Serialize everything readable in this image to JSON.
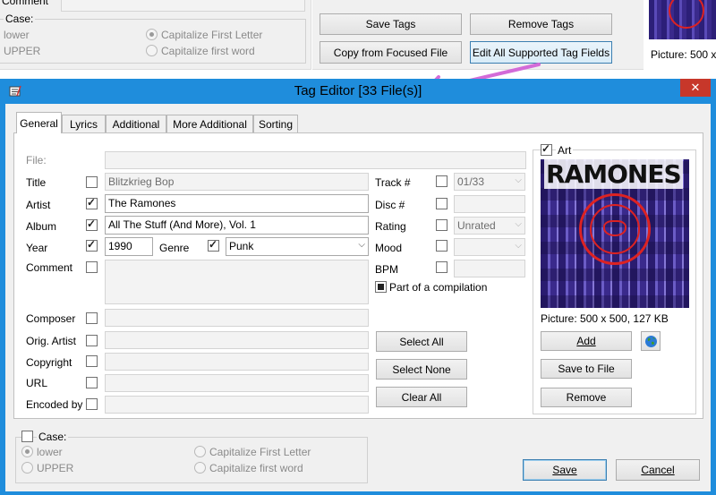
{
  "background_window": {
    "comment_label": "Comment",
    "case_label": "Case:",
    "lower_label": "lower",
    "upper_label": "UPPER",
    "capitalize_first_letter": "Capitalize First Letter",
    "capitalize_first_word": "Capitalize first word",
    "buttons": {
      "save_tags": "Save Tags",
      "remove_tags": "Remove Tags",
      "copy_from_focused": "Copy from Focused File",
      "edit_all_supported": "Edit All Supported Tag Fields"
    },
    "picture_info": "Picture: 500 x"
  },
  "dialog": {
    "title": "Tag Editor [33 File(s)]",
    "close_glyph": "✕",
    "tabs": [
      "General",
      "Lyrics",
      "Additional",
      "More Additional",
      "Sorting"
    ],
    "fields": {
      "file_label": "File:",
      "title_label": "Title",
      "title_value": "Blitzkrieg Bop",
      "artist_label": "Artist",
      "artist_value": "The Ramones",
      "album_label": "Album",
      "album_value": "All The Stuff (And More), Vol. 1",
      "year_label": "Year",
      "year_value": "1990",
      "genre_label": "Genre",
      "genre_value": "Punk",
      "comment_label": "Comment",
      "composer_label": "Composer",
      "orig_artist_label": "Orig. Artist",
      "copyright_label": "Copyright",
      "url_label": "URL",
      "encoded_by_label": "Encoded by",
      "track_label": "Track #",
      "track_value": "01/33",
      "disc_label": "Disc #",
      "rating_label": "Rating",
      "rating_value": "Unrated",
      "mood_label": "Mood",
      "bpm_label": "BPM",
      "compilation_label": "Part of a compilation"
    },
    "middle_buttons": {
      "select_all": "Select All",
      "select_none": "Select None",
      "clear_all": "Clear All"
    },
    "art": {
      "label": "Art",
      "picture_info": "Picture: 500 x 500, 127 KB",
      "cover_text": "RAMONES",
      "add": "Add",
      "save_to_file": "Save to File",
      "remove": "Remove"
    },
    "case": {
      "label": "Case:",
      "lower": "lower",
      "upper": "UPPER",
      "capitalize_first_letter": "Capitalize First Letter",
      "capitalize_first_word": "Capitalize first word"
    },
    "footer": {
      "save": "Save",
      "cancel": "Cancel"
    }
  },
  "colors": {
    "titlebar": "#1f8ddc",
    "close_button": "#c7372a",
    "annotation_arrow": "#d36bd8",
    "album_art_bg": "#3a2a8c"
  }
}
